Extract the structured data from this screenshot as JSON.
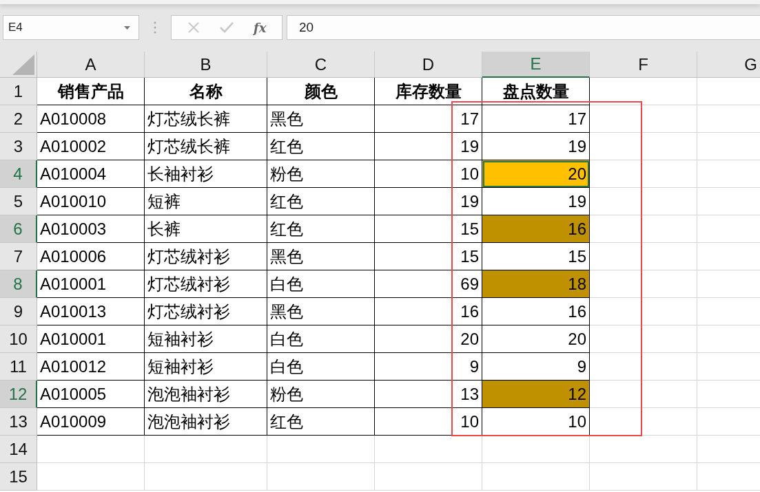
{
  "formula_bar": {
    "name_box": "E4",
    "buttons": [
      {
        "kind": "cancel",
        "disabled": true
      },
      {
        "kind": "enter",
        "disabled": true
      }
    ],
    "function_label": "fx",
    "value": "20"
  },
  "columns": [
    {
      "letter": "A",
      "selected": false
    },
    {
      "letter": "B",
      "selected": false
    },
    {
      "letter": "C",
      "selected": false
    },
    {
      "letter": "D",
      "selected": false
    },
    {
      "letter": "E",
      "selected": true
    },
    {
      "letter": "F",
      "selected": false
    },
    {
      "letter": "G",
      "selected": false
    }
  ],
  "rows": [
    {
      "number": "1",
      "kind": "header",
      "selected": false,
      "cells": [
        {
          "text": "销售产品",
          "active": false
        },
        {
          "text": "名称",
          "active": false
        },
        {
          "text": "颜色",
          "active": false
        },
        {
          "text": "库存数量",
          "active": false
        },
        {
          "text": "盘点数量",
          "active": false
        }
      ]
    },
    {
      "number": "2",
      "kind": "data",
      "selected": false,
      "cells": [
        {
          "text": "A010008",
          "active": false
        },
        {
          "text": "灯芯绒长裤",
          "active": false
        },
        {
          "text": "黑色",
          "active": false
        },
        {
          "text": "17",
          "active": false
        },
        {
          "text": "17",
          "active": false
        }
      ]
    },
    {
      "number": "3",
      "kind": "data",
      "selected": false,
      "cells": [
        {
          "text": "A010002",
          "active": false
        },
        {
          "text": "灯芯绒长裤",
          "active": false
        },
        {
          "text": "红色",
          "active": false
        },
        {
          "text": "19",
          "active": false
        },
        {
          "text": "19",
          "active": false
        }
      ]
    },
    {
      "number": "4",
      "kind": "data",
      "selected": true,
      "cells": [
        {
          "text": "A010004",
          "active": false
        },
        {
          "text": "长袖衬衫",
          "active": false
        },
        {
          "text": "粉色",
          "active": false
        },
        {
          "text": "10",
          "active": false
        },
        {
          "text": "20",
          "active": true,
          "color": "#ffc000"
        }
      ]
    },
    {
      "number": "5",
      "kind": "data",
      "selected": false,
      "cells": [
        {
          "text": "A010010",
          "active": false
        },
        {
          "text": "短裤",
          "active": false
        },
        {
          "text": "红色",
          "active": false
        },
        {
          "text": "19",
          "active": false
        },
        {
          "text": "19",
          "active": false
        }
      ]
    },
    {
      "number": "6",
      "kind": "data",
      "selected": true,
      "cells": [
        {
          "text": "A010003",
          "active": false
        },
        {
          "text": "长裤",
          "active": false
        },
        {
          "text": "红色",
          "active": false
        },
        {
          "text": "15",
          "active": false
        },
        {
          "text": "16",
          "active": false,
          "color": "#bf9000"
        }
      ]
    },
    {
      "number": "7",
      "kind": "data",
      "selected": false,
      "cells": [
        {
          "text": "A010006",
          "active": false
        },
        {
          "text": "灯芯绒衬衫",
          "active": false
        },
        {
          "text": "黑色",
          "active": false
        },
        {
          "text": "15",
          "active": false
        },
        {
          "text": "15",
          "active": false
        }
      ]
    },
    {
      "number": "8",
      "kind": "data",
      "selected": true,
      "cells": [
        {
          "text": "A010001",
          "active": false
        },
        {
          "text": "灯芯绒衬衫",
          "active": false
        },
        {
          "text": "白色",
          "active": false
        },
        {
          "text": "69",
          "active": false
        },
        {
          "text": "18",
          "active": false,
          "color": "#bf9000"
        }
      ]
    },
    {
      "number": "9",
      "kind": "data",
      "selected": false,
      "cells": [
        {
          "text": "A010013",
          "active": false
        },
        {
          "text": "灯芯绒衬衫",
          "active": false
        },
        {
          "text": "黑色",
          "active": false
        },
        {
          "text": "16",
          "active": false
        },
        {
          "text": "16",
          "active": false
        }
      ]
    },
    {
      "number": "10",
      "kind": "data",
      "selected": false,
      "cells": [
        {
          "text": "A010001",
          "active": false
        },
        {
          "text": "短袖衬衫",
          "active": false
        },
        {
          "text": "白色",
          "active": false
        },
        {
          "text": "20",
          "active": false
        },
        {
          "text": "20",
          "active": false
        }
      ]
    },
    {
      "number": "11",
      "kind": "data",
      "selected": false,
      "cells": [
        {
          "text": "A010012",
          "active": false
        },
        {
          "text": "短袖衬衫",
          "active": false
        },
        {
          "text": "白色",
          "active": false
        },
        {
          "text": "9",
          "active": false
        },
        {
          "text": "9",
          "active": false
        }
      ]
    },
    {
      "number": "12",
      "kind": "data",
      "selected": true,
      "cells": [
        {
          "text": "A010005",
          "active": false
        },
        {
          "text": "泡泡袖衬衫",
          "active": false
        },
        {
          "text": "粉色",
          "active": false
        },
        {
          "text": "13",
          "active": false
        },
        {
          "text": "12",
          "active": false,
          "color": "#bf9000"
        }
      ]
    },
    {
      "number": "13",
      "kind": "data",
      "selected": false,
      "cells": [
        {
          "text": "A010009",
          "active": false
        },
        {
          "text": "泡泡袖衬衫",
          "active": false
        },
        {
          "text": "红色",
          "active": false
        },
        {
          "text": "10",
          "active": false
        },
        {
          "text": "10",
          "active": false
        }
      ]
    },
    {
      "number": "14",
      "kind": "empty",
      "selected": false
    },
    {
      "number": "15",
      "kind": "empty",
      "selected": false
    }
  ],
  "overlay": {
    "kind": "outline-rectangle"
  }
}
